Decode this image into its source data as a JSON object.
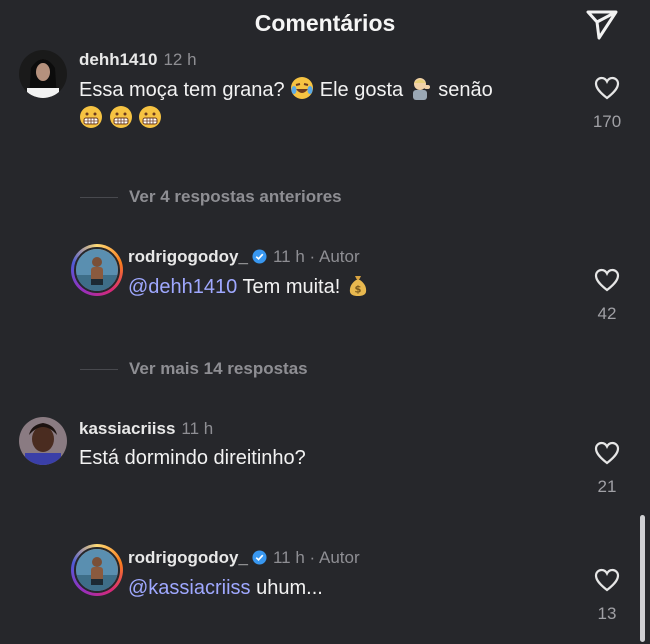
{
  "header": {
    "title": "Comentários",
    "share_icon": "paper-plane-icon"
  },
  "comments": [
    {
      "username": "dehh1410",
      "time": "12 h",
      "text_parts": [
        "Essa moça tem grana? ",
        " Ele gosta ",
        " senão"
      ],
      "emojis": [
        "tears-of-joy-emoji",
        "man-tipping-hand-emoji",
        "grimacing-emoji",
        "grimacing-emoji",
        "grimacing-emoji"
      ],
      "likes": "170"
    },
    {
      "username": "rodrigogodoy_",
      "time": "11 h",
      "author_sep": "·",
      "author_label": "Autor",
      "mention": "@dehh1410",
      "text": " Tem muita! ",
      "emojis": [
        "money-bag-emoji"
      ],
      "likes": "42"
    },
    {
      "username": "kassiacriiss",
      "time": "11 h",
      "text": "Está dormindo direitinho?",
      "likes": "21"
    },
    {
      "username": "rodrigogodoy_",
      "time": "11 h",
      "author_sep": "·",
      "author_label": "Autor",
      "mention": "@kassiacriiss",
      "text": " uhum...",
      "likes": "13"
    }
  ],
  "replies_toggle": [
    {
      "label": "Ver 4 respostas anteriores"
    },
    {
      "label": "Ver mais 14 respostas"
    }
  ],
  "colors": {
    "background": "#26272b",
    "mention": "#9fa8ff",
    "muted": "#8e8e93",
    "verified": "#3897f0"
  }
}
